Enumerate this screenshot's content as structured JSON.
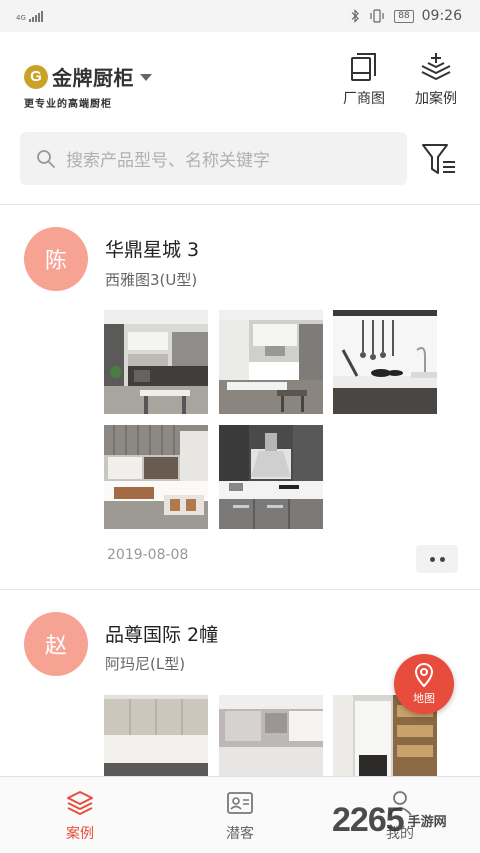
{
  "status_bar": {
    "network": "4G",
    "battery": "88",
    "time": "09:26"
  },
  "header": {
    "logo": {
      "brand_name": "金牌厨柜",
      "slogan": "更专业的高端厨柜",
      "mark_letter": "G"
    },
    "actions": [
      {
        "label": "厂商图",
        "icon": "brochure-icon"
      },
      {
        "label": "加案例",
        "icon": "add-layers-icon"
      }
    ]
  },
  "search": {
    "placeholder": "搜索产品型号、名称关键字"
  },
  "cases": [
    {
      "avatar_char": "陈",
      "title": "华鼎星城 3",
      "subtitle": "西雅图3(U型)",
      "date": "2019-08-08",
      "photo_count": 5
    },
    {
      "avatar_char": "赵",
      "title": "品尊国际 2幢",
      "subtitle": "阿玛尼(L型)",
      "photo_count": 3
    }
  ],
  "map_button": {
    "label": "地图"
  },
  "tabs": [
    {
      "label": "案例",
      "icon": "layers-icon",
      "active": true
    },
    {
      "label": "潜客",
      "icon": "contact-card-icon",
      "active": false
    },
    {
      "label": "我的",
      "icon": "person-icon",
      "active": false
    }
  ],
  "watermark": {
    "number": "2265",
    "text": "手游网"
  },
  "colors": {
    "accent": "#e74c3c",
    "avatar_bg": "#f7a394",
    "logo_gold": "#c9a227"
  }
}
